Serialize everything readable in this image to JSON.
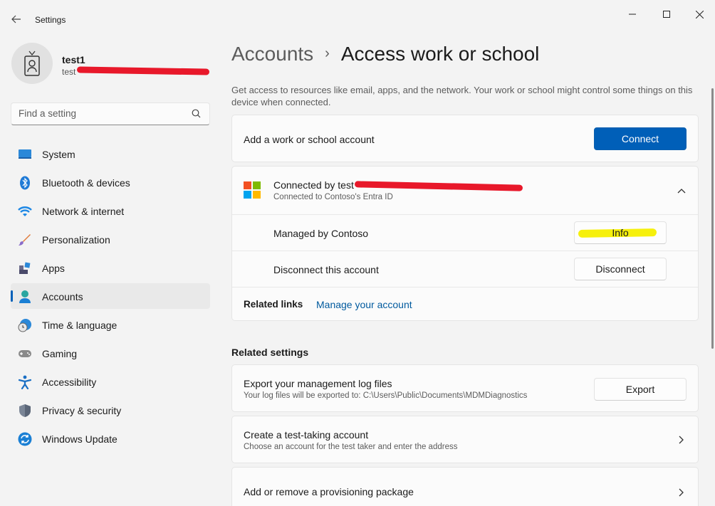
{
  "window": {
    "app_title": "Settings",
    "controls": [
      "minimize-icon",
      "maximize-icon",
      "close-icon"
    ]
  },
  "profile": {
    "name": "test1",
    "email": "test"
  },
  "search": {
    "placeholder": "Find a setting"
  },
  "sidebar": {
    "items": [
      {
        "label": "System",
        "icon": "system-icon"
      },
      {
        "label": "Bluetooth & devices",
        "icon": "bluetooth-icon"
      },
      {
        "label": "Network & internet",
        "icon": "network-icon"
      },
      {
        "label": "Personalization",
        "icon": "personalization-icon"
      },
      {
        "label": "Apps",
        "icon": "apps-icon"
      },
      {
        "label": "Accounts",
        "icon": "accounts-icon",
        "active": true
      },
      {
        "label": "Time & language",
        "icon": "time-language-icon"
      },
      {
        "label": "Gaming",
        "icon": "gaming-icon"
      },
      {
        "label": "Accessibility",
        "icon": "accessibility-icon"
      },
      {
        "label": "Privacy & security",
        "icon": "privacy-icon"
      },
      {
        "label": "Windows Update",
        "icon": "windows-update-icon"
      }
    ]
  },
  "breadcrumb": {
    "parent": "Accounts",
    "separator": "›",
    "current": "Access work or school"
  },
  "description": "Get access to resources like email, apps, and the network. Your work or school might control some things on this device when connected.",
  "add_account": {
    "label": "Add a work or school account",
    "button": "Connect"
  },
  "connected_account": {
    "title": "Connected by test",
    "subtitle": "Connected to Contoso's Entra ID",
    "managed_label": "Managed by Contoso",
    "info_button": "Info",
    "disconnect_label": "Disconnect this account",
    "disconnect_button": "Disconnect",
    "related_links_label": "Related links",
    "manage_link": "Manage your account"
  },
  "related_settings": {
    "title": "Related settings",
    "export": {
      "label": "Export your management log files",
      "sublabel": "Your log files will be exported to: C:\\Users\\Public\\Documents\\MDMDiagnostics",
      "button": "Export"
    },
    "test_account": {
      "label": "Create a test-taking account",
      "sublabel": "Choose an account for the test taker and enter the address"
    },
    "provisioning": {
      "label": "Add or remove a provisioning package"
    }
  },
  "colors": {
    "accent": "#005fb8",
    "background": "#f3f3f3",
    "card": "#fbfbfb"
  }
}
